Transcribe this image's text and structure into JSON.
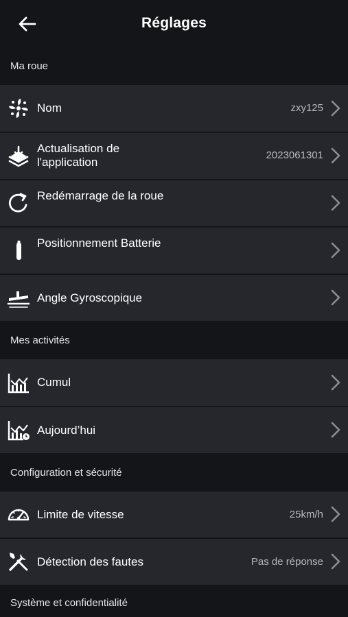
{
  "header": {
    "title": "Réglages",
    "back_icon": "arrow-left-icon"
  },
  "sections": {
    "ma_roue": "Ma roue",
    "mes_activites": "Mes activités",
    "config": "Configuration et sécurité",
    "systeme": "Système et confidentialité"
  },
  "rows": {
    "nom": {
      "label": "Nom",
      "value": "zxy125",
      "icon": "pinwheel-icon"
    },
    "actualisation": {
      "label": "Actualisation de l'application",
      "value": "2023061301",
      "icon": "update-layers-icon"
    },
    "redemarrage": {
      "label": "Redémarrage de la roue",
      "value": "",
      "icon": "restart-icon"
    },
    "batterie": {
      "label": "Positionnement Batterie",
      "value": "",
      "icon": "battery-icon"
    },
    "gyro": {
      "label": "Angle Gyroscopique",
      "value": "",
      "icon": "gyroscope-angle-icon"
    },
    "cumul": {
      "label": "Cumul",
      "value": "",
      "icon": "bar-chart-icon"
    },
    "aujourdhui": {
      "label": "Aujourd’hui",
      "value": "",
      "icon": "bar-chart-clock-icon"
    },
    "vitesse": {
      "label": "Limite de vitesse",
      "value": "25km/h",
      "icon": "speedometer-icon"
    },
    "fautes": {
      "label": "Détection des fautes",
      "value": "Pas de réponse",
      "icon": "tools-icon"
    }
  },
  "colors": {
    "background": "#141519",
    "row": "#25272c",
    "text": "#ffffff",
    "value": "#b8b9bc",
    "chevron": "#8d8e92"
  }
}
